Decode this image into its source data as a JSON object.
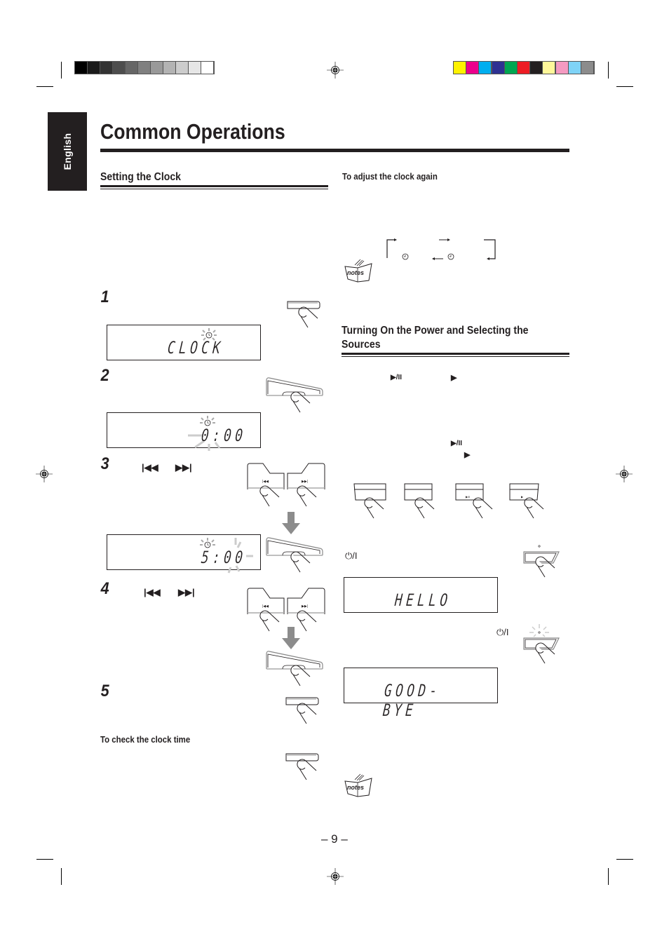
{
  "print_marks": {
    "grayscale_bar": [
      "#000000",
      "#1a1a1a",
      "#333333",
      "#4d4d4d",
      "#666666",
      "#808080",
      "#999999",
      "#b3b3b3",
      "#cccccc",
      "#e6e6e6",
      "#ffffff"
    ],
    "color_bar": [
      "#fff200",
      "#ec008c",
      "#00aeef",
      "#2e3192",
      "#00a651",
      "#ed1c24",
      "#231f20",
      "#fff79a",
      "#f49ac1",
      "#7fd3f7",
      "#8c8c8c"
    ]
  },
  "sidebar": {
    "language_tab": "English"
  },
  "page": {
    "title": "Common Operations",
    "page_number": "– 9 –"
  },
  "left": {
    "section_title": "Setting the Clock",
    "steps": [
      {
        "number": "1",
        "display": "CLOCK"
      },
      {
        "number": "2",
        "display": "0:00"
      },
      {
        "number": "3",
        "buttons": [
          "|◀◀",
          "▶▶|"
        ],
        "display": "5:00"
      },
      {
        "number": "4",
        "buttons": [
          "|◀◀",
          "▶▶|"
        ]
      },
      {
        "number": "5"
      }
    ],
    "check_clock_heading": "To check the clock time"
  },
  "right": {
    "adjust_heading": "To adjust the clock again",
    "section_title_line1": "Turning On the Power and Selecting the",
    "section_title_line2": "Sources",
    "play_pause_symbol": "▶/II",
    "play_symbol": "▶",
    "power_symbol": "⏻/I",
    "displays": {
      "hello": "HELLO",
      "goodbye": "GOOD-BYE"
    },
    "notes_label": "notes"
  }
}
